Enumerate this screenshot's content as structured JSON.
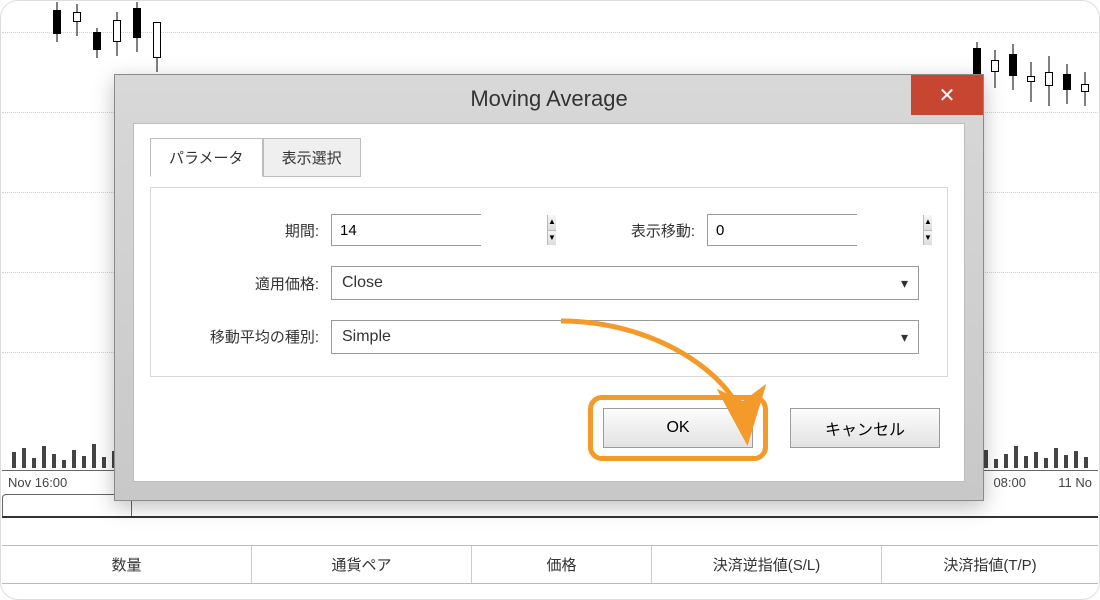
{
  "dialog": {
    "title": "Moving Average",
    "tabs": {
      "parameters": "パラメータ",
      "display": "表示選択"
    },
    "fields": {
      "period_label": "期間:",
      "period_value": "14",
      "shift_label": "表示移動:",
      "shift_value": "0",
      "apply_label": "適用価格:",
      "apply_value": "Close",
      "method_label": "移動平均の種別:",
      "method_value": "Simple"
    },
    "buttons": {
      "ok": "OK",
      "cancel": "キャンセル"
    }
  },
  "timeAxis": {
    "left": "Nov 16:00",
    "right1": "08:00",
    "right2": "11 No"
  },
  "bottomHeader": {
    "qty": "数量",
    "pair": "通貨ペア",
    "price": "価格",
    "sl": "決済逆指値(S/L)",
    "tp": "決済指値(T/P)"
  }
}
